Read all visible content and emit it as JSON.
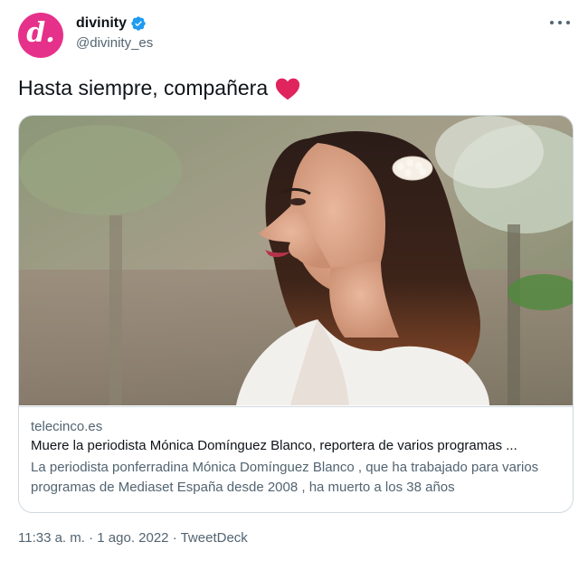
{
  "account": {
    "name": "divinity",
    "handle": "@divinity_es",
    "avatar_letter": "d.",
    "avatar_color": "#e6318a",
    "verified_color": "#1d9bf0"
  },
  "tweet": {
    "text": "Hasta siempre, compañera",
    "emoji": "red-heart",
    "heart_color": "#e0245e"
  },
  "card": {
    "image_icon": "photo-portrait-woman",
    "domain": "telecinco.es",
    "title": "Muere la periodista Mónica Domínguez Blanco, reportera de varios programas ...",
    "description": "La periodista ponferradina Mónica Domínguez Blanco , que ha trabajado para varios programas de Mediaset España desde 2008 , ha muerto a los 38 años"
  },
  "meta": {
    "time": "11:33 a. m.",
    "separator": " · ",
    "date": "1 ago. 2022",
    "source": "TweetDeck"
  }
}
